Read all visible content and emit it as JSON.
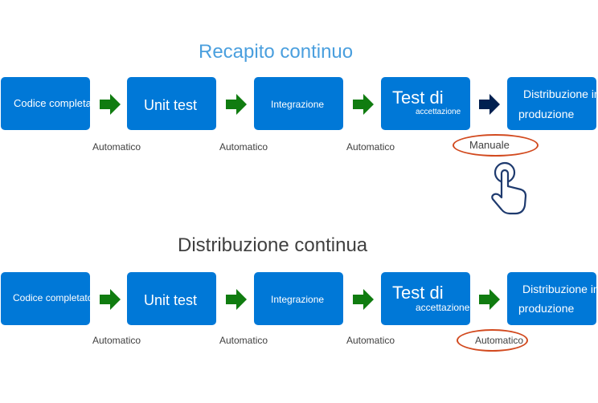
{
  "rows": [
    {
      "title": "Recapito continuo",
      "steps": [
        {
          "line1": "Codice completato"
        },
        {
          "line1": "Unit test"
        },
        {
          "line1": "Integrazione"
        },
        {
          "line1": "Test di",
          "line2": "accettazione"
        },
        {
          "line1": "Distribuzione in",
          "line2": "produzione"
        }
      ],
      "transitions": [
        "Automatico",
        "Automatico",
        "Automatico",
        "Manuale"
      ],
      "arrow_colors": [
        "#107c10",
        "#107c10",
        "#107c10",
        "#002050"
      ]
    },
    {
      "title": "Distribuzione continua",
      "steps": [
        {
          "line1": "Codice completato"
        },
        {
          "line1": "Unit test"
        },
        {
          "line1": "Integrazione"
        },
        {
          "line1": "Test di",
          "line2": "accettazione"
        },
        {
          "line1": "Distribuzione in",
          "line2": "produzione"
        }
      ],
      "transitions": [
        "Automatico",
        "Automatico",
        "Automatico",
        "Automatico"
      ],
      "arrow_colors": [
        "#107c10",
        "#107c10",
        "#107c10",
        "#107c10"
      ]
    }
  ],
  "colors": {
    "box": "#0078d7",
    "highlight": "#d24a1f",
    "hand": "#1e3a6e"
  },
  "icons": {
    "manual": "hand-pointer-icon"
  }
}
